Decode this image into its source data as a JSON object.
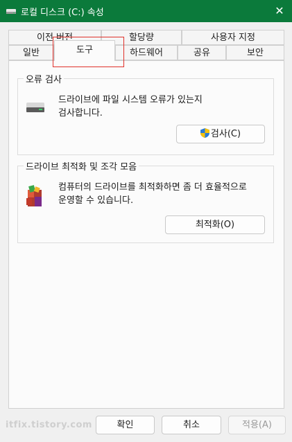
{
  "window": {
    "title": "로컬 디스크 (C:) 속성",
    "close_glyph": "✕",
    "accent_color": "#0b7a3b"
  },
  "tabs": {
    "row1": [
      {
        "label": "이전 버전"
      },
      {
        "label": "할당량"
      },
      {
        "label": "사용자 지정"
      }
    ],
    "row2": [
      {
        "label": "일반"
      },
      {
        "label": "도구",
        "active": true
      },
      {
        "label": "하드웨어"
      },
      {
        "label": "공유"
      },
      {
        "label": "보안"
      }
    ]
  },
  "error_check": {
    "title": "오류 검사",
    "description_line1": "드라이브에 파일 시스템 오류가 있는지",
    "description_line2": "검사합니다.",
    "button_label": "검사(C)",
    "icon": "drive-icon"
  },
  "optimize": {
    "title": "드라이브 최적화 및 조각 모음",
    "description_line1": "컴퓨터의 드라이브를 최적화하면 좀 더 효율적으로",
    "description_line2": "운영할 수 있습니다.",
    "button_label": "최적화(O)",
    "icon": "defrag-icon"
  },
  "footer": {
    "ok_label": "확인",
    "cancel_label": "취소",
    "apply_label": "적용(A)",
    "watermark": "itfix.tistory.com"
  }
}
